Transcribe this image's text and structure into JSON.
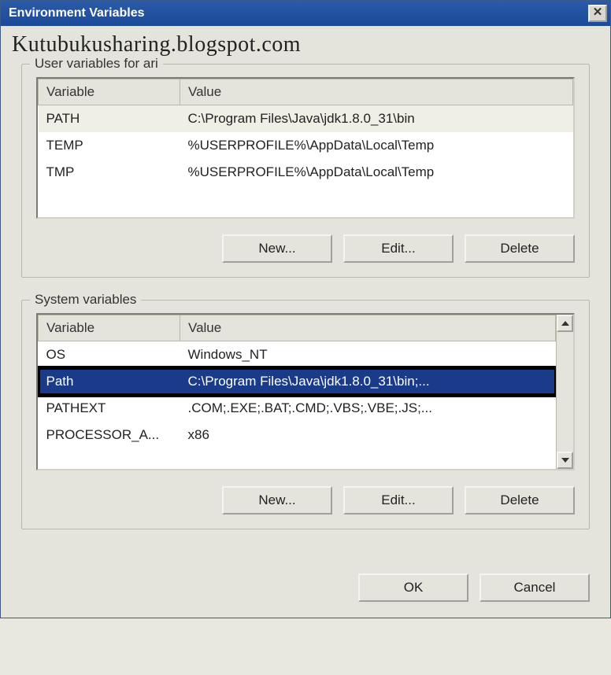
{
  "titlebar": {
    "title": "Environment Variables",
    "close": "✕"
  },
  "watermark": "Kutubukusharing.blogspot.com",
  "userSection": {
    "label": "User variables for ari",
    "headers": {
      "variable": "Variable",
      "value": "Value"
    },
    "rows": [
      {
        "variable": "PATH",
        "value": "C:\\Program Files\\Java\\jdk1.8.0_31\\bin",
        "selected": true
      },
      {
        "variable": "TEMP",
        "value": "%USERPROFILE%\\AppData\\Local\\Temp",
        "selected": false
      },
      {
        "variable": "TMP",
        "value": "%USERPROFILE%\\AppData\\Local\\Temp",
        "selected": false
      }
    ],
    "buttons": {
      "new": "New...",
      "edit": "Edit...",
      "delete": "Delete"
    }
  },
  "systemSection": {
    "label": "System variables",
    "headers": {
      "variable": "Variable",
      "value": "Value"
    },
    "rows": [
      {
        "variable": "OS",
        "value": "Windows_NT",
        "selected": false
      },
      {
        "variable": "Path",
        "value": "C:\\Program Files\\Java\\jdk1.8.0_31\\bin;...",
        "selected": true
      },
      {
        "variable": "PATHEXT",
        "value": ".COM;.EXE;.BAT;.CMD;.VBS;.VBE;.JS;...",
        "selected": false
      },
      {
        "variable": "PROCESSOR_A...",
        "value": "x86",
        "selected": false
      }
    ],
    "buttons": {
      "new": "New...",
      "edit": "Edit...",
      "delete": "Delete"
    }
  },
  "dialog": {
    "ok": "OK",
    "cancel": "Cancel"
  }
}
